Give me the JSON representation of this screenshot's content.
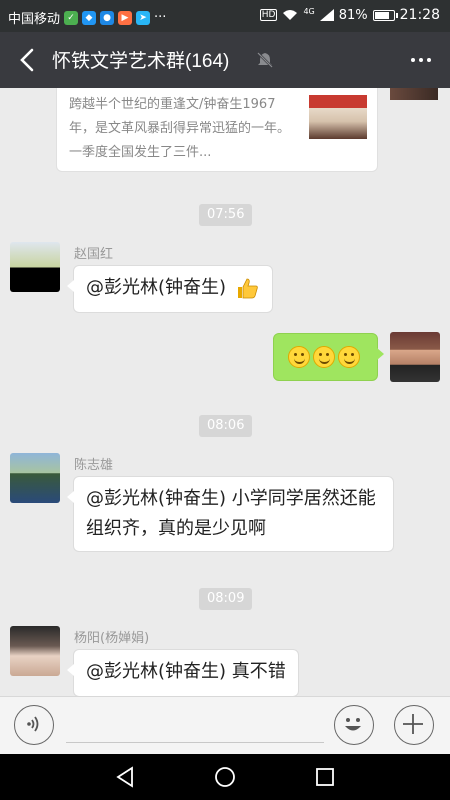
{
  "status_bar": {
    "carrier": "中国移动",
    "signal_label": "4G",
    "hd_label": "HD",
    "battery": "81%",
    "battery_level": 0.81,
    "time": "21:28",
    "more": "···"
  },
  "header": {
    "title": "怀铁文学艺术群(164)",
    "icons": [
      "back-arrow-icon",
      "mute-bell-icon",
      "more-dots-icon"
    ]
  },
  "link_card": {
    "description": "跨越半个世纪的重逢文/钟奋生1967年，是文革风暴刮得异常迅猛的一年。一季度全国发生了三件..."
  },
  "messages": [
    {
      "type": "time",
      "text": "07:56"
    },
    {
      "type": "incoming",
      "sender": "赵国红",
      "text": "@彭光林(钟奋生)",
      "emoji": "thumbs-up-icon"
    },
    {
      "type": "outgoing",
      "emoji": [
        "smiley-icon",
        "smiley-icon",
        "smiley-icon"
      ]
    },
    {
      "type": "time",
      "text": "08:06"
    },
    {
      "type": "incoming",
      "sender": "陈志雄",
      "text": "@彭光林(钟奋生) 小学同学居然还能组织齐，真的是少见啊"
    },
    {
      "type": "time",
      "text": "08:09"
    },
    {
      "type": "incoming",
      "sender": "杨阳(杨婵娟)",
      "text": "@彭光林(钟奋生) 真不错"
    }
  ],
  "input_bar": {
    "value": "",
    "icons": [
      "voice-icon",
      "emoji-icon",
      "plus-icon"
    ]
  },
  "nav_bar": {
    "icons": [
      "back-triangle-icon",
      "home-circle-icon",
      "recents-square-icon"
    ]
  },
  "colors": {
    "header_bg": "#393a3f",
    "chat_bg": "#ebebeb",
    "outgoing_bubble": "#9fe55f"
  }
}
